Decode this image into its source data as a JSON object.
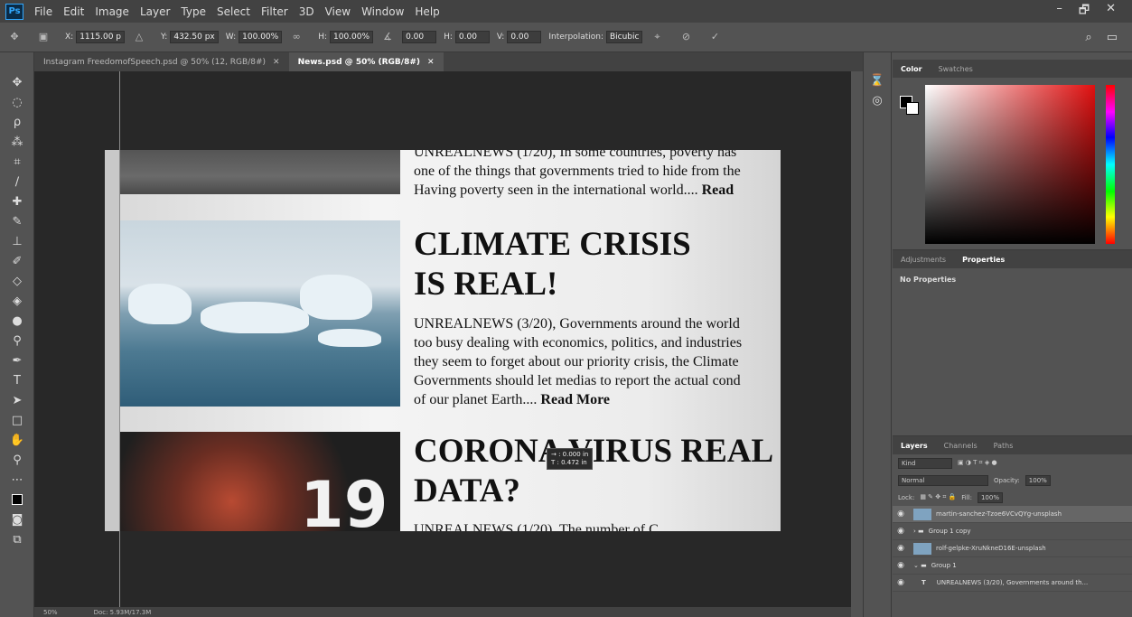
{
  "menubar": {
    "logo": "Ps",
    "items": [
      "File",
      "Edit",
      "Image",
      "Layer",
      "Type",
      "Select",
      "Filter",
      "3D",
      "View",
      "Window",
      "Help"
    ],
    "controls": [
      "–",
      "🗗",
      "✕"
    ]
  },
  "options": {
    "x_label": "X:",
    "x_value": "1115.00 p",
    "y_label": "Y:",
    "y_value": "432.50 px",
    "w_label": "W:",
    "w_value": "100.00%",
    "h_label": "H:",
    "h_value": "100.00%",
    "angle_value": "0.00",
    "hskew_label": "H:",
    "hskew_value": "0.00",
    "vskew_label": "V:",
    "vskew_value": "0.00",
    "interp_label": "Interpolation:",
    "interp_value": "Bicubic"
  },
  "tabs": [
    {
      "label": "Instagram FreedomofSpeech.psd @ 50% (12, RGB/8#)",
      "close": "✕"
    },
    {
      "label": "News.psd @ 50% (RGB/8#)",
      "close": "✕"
    }
  ],
  "canvas": {
    "article1_line1": "UNREALNEWS (1/20), In some countries, poverty has",
    "article1_line2": "one of the things that governments tried to hide from the",
    "article1_line3": "Having poverty seen in the international world....",
    "article1_read": "Read",
    "article2_head1": "CLIMATE CRISIS",
    "article2_head2": "IS REAL!",
    "article2_line1": "UNREALNEWS (3/20), Governments around the world",
    "article2_line2": "too busy dealing with economics, politics, and industries",
    "article2_line3": "they seem to forget about our priority crisis, the Climate",
    "article2_line4": "Governments should let medias to report the actual cond",
    "article2_line5": "of our planet Earth....",
    "article2_read": "Read More",
    "article3_head1": "CORONA VIRUS REAL",
    "article3_head2": "DATA?",
    "article3_line1": "UNREALNEWS (1/20), The number of C",
    "covid_text": "19"
  },
  "tooltip": {
    "line1": "→ : 0.000 in",
    "line2": "T : 0.472 in"
  },
  "status": {
    "zoom": "50%",
    "doc": "Doc: 5.93M/17.3M"
  },
  "color_panel": {
    "tabs": [
      "Color",
      "Swatches"
    ]
  },
  "props_panel": {
    "tabs": [
      "Adjustments",
      "Properties"
    ],
    "content": "No Properties"
  },
  "layers_panel": {
    "tabs": [
      "Layers",
      "Channels",
      "Paths"
    ],
    "kind": "Kind",
    "blend": "Normal",
    "opacity_label": "Opacity:",
    "opacity_value": "100%",
    "lock_label": "Lock:",
    "fill_label": "Fill:",
    "fill_value": "100%",
    "layers": [
      {
        "name": "martin-sanchez-Tzoe6VCvQYg-unsplash"
      },
      {
        "name": "Group 1 copy"
      },
      {
        "name": "rolf-gelpke-XruNkneD16E-unsplash"
      },
      {
        "name": "Group 1"
      },
      {
        "name": "UNREALNEWS (3/20), Governments around th..."
      }
    ]
  }
}
